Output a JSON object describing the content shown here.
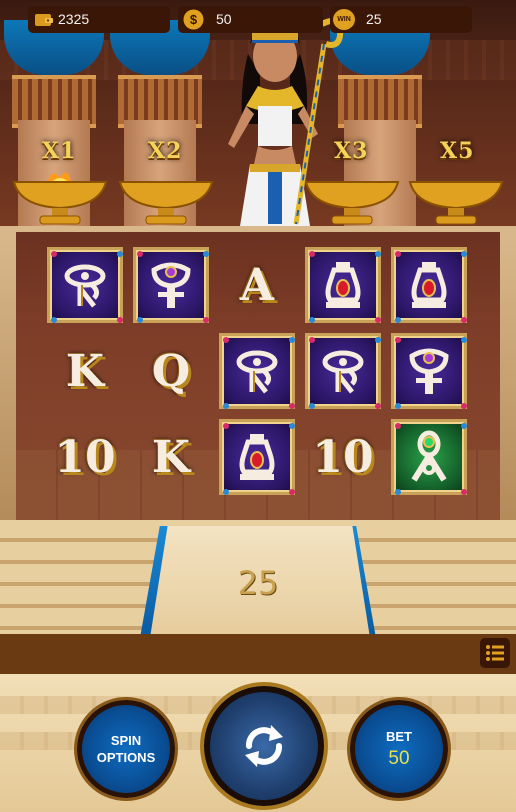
{
  "multipliers": [
    "X1",
    "X2",
    "X3",
    "X5"
  ],
  "reels": [
    [
      "eye",
      "K",
      "10"
    ],
    [
      "ankh-purple",
      "Q",
      "K"
    ],
    [
      "A",
      "eye",
      "vase"
    ],
    [
      "vase",
      "eye",
      "10"
    ],
    [
      "vase",
      "ankh-purple",
      "ankh-green"
    ]
  ],
  "win_display": "25",
  "status": {
    "balance": "2325",
    "coin_value": "50",
    "win_badge": "WIN",
    "win_value": "25"
  },
  "controls": {
    "spin_options_label": "SPIN OPTIONS",
    "bet_label": "BET",
    "bet_value": "50"
  },
  "colors": {
    "accent_gold": "#f5d35a",
    "button_blue": "#0a4e94",
    "bet_value_yellow": "#e8e04a"
  }
}
